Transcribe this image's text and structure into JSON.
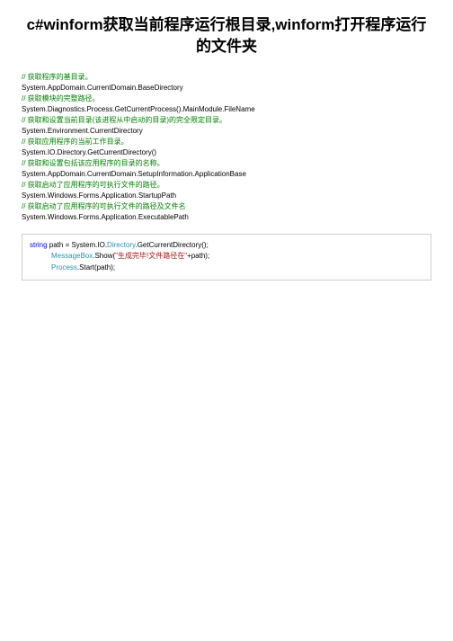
{
  "title": "c#winform获取当前程序运行根目录,winform打开程序运行的文件夹",
  "lines": [
    {
      "text": "// 获取程序的基目录。",
      "cls": "comment"
    },
    {
      "text": "System.AppDomain.CurrentDomain.BaseDirectory",
      "cls": ""
    },
    {
      "text": "// 获取模块的完整路径。",
      "cls": "comment"
    },
    {
      "text": "System.Diagnostics.Process.GetCurrentProcess().MainModule.FileName",
      "cls": ""
    },
    {
      "text": "// 获取和设置当前目录(该进程从中启动的目录)的完全限定目录。",
      "cls": "comment"
    },
    {
      "text": "System.Environment.CurrentDirectory",
      "cls": ""
    },
    {
      "text": "// 获取应用程序的当前工作目录。",
      "cls": "comment"
    },
    {
      "text": "System.IO.Directory.GetCurrentDirectory()",
      "cls": ""
    },
    {
      "text": "// 获取和设置包括该应用程序的目录的名称。",
      "cls": "comment"
    },
    {
      "text": "System.AppDomain.CurrentDomain.SetupInformation.ApplicationBase",
      "cls": ""
    },
    {
      "text": "// 获取启动了应用程序的可执行文件的路径。",
      "cls": "comment"
    },
    {
      "text": "System.Windows.Forms.Application.StartupPath",
      "cls": ""
    },
    {
      "text": "// 获取启动了应用程序的可执行文件的路径及文件名",
      "cls": "comment"
    },
    {
      "text": "System.Windows.Forms.Application.ExecutablePath",
      "cls": ""
    }
  ],
  "code": {
    "l1": {
      "kw": "string",
      "mid1": " path = System.IO.",
      "cls1": "Directory",
      "end1": ".GetCurrentDirectory();"
    },
    "l2": {
      "cls1": "MessageBox",
      "mid1": ".Show(",
      "str1": "\"生成完毕!文件路径在\"",
      "end1": "+path);"
    },
    "l3": {
      "cls1": "Process",
      "end1": ".Start(path);"
    }
  }
}
